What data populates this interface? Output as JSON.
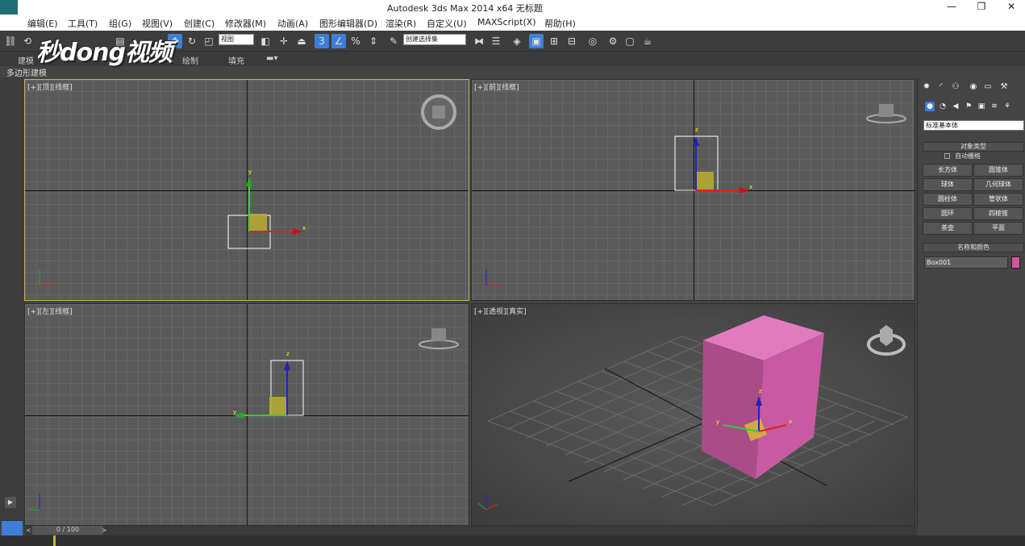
{
  "window": {
    "title": "Autodesk 3ds Max  2014 x64     无标题",
    "min": "—",
    "max": "❐",
    "close": "✕"
  },
  "menu": [
    "编辑(E)",
    "工具(T)",
    "组(G)",
    "视图(V)",
    "创建(C)",
    "修改器(M)",
    "动画(A)",
    "图形编辑器(D)",
    "渲染(R)",
    "自定义(U)",
    "MAXScript(X)",
    "帮助(H)"
  ],
  "toolbar": {
    "view_select": "视图",
    "named_selection": "创建选择集"
  },
  "ribbon": {
    "tab_model": "建模",
    "tab_draw": "绘制",
    "tab_fill": "填充",
    "sub_label": "多边形建模"
  },
  "watermark": "秒dong视频",
  "viewports": {
    "top": "[+][顶][线框]",
    "front": "[+][前][线框]",
    "left": "[+][左][线框]",
    "persp": "[+][透视][真实]"
  },
  "axes": {
    "x": "x",
    "y": "y",
    "z": "z"
  },
  "command_panel": {
    "primitive_type": "标准基本体",
    "object_type_header": "对象类型",
    "autogrid": "自动栅格",
    "buttons": [
      "长方体",
      "圆锥体",
      "球体",
      "几何球体",
      "圆柱体",
      "管状体",
      "圆环",
      "四棱锥",
      "茶壶",
      "平面"
    ],
    "name_color_header": "名称和颜色",
    "object_name": "Box001",
    "object_color": "#d6539c"
  },
  "timeline": {
    "frame": "0 / 100",
    "prev": "<",
    "next": ">"
  }
}
